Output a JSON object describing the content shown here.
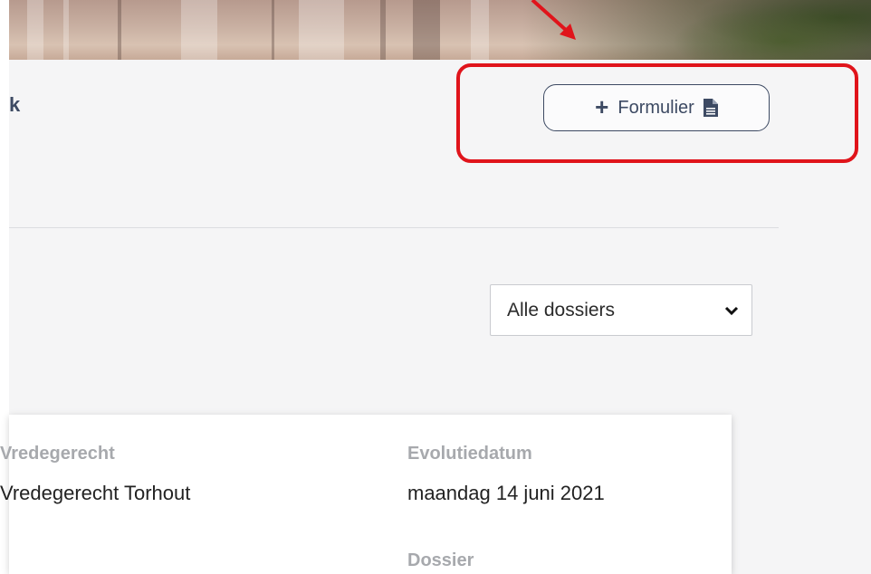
{
  "header": {
    "title_fragment": "k",
    "add_form_button": {
      "label": "Formulier",
      "icon": "document-icon",
      "plus_icon": "plus-icon"
    }
  },
  "filter": {
    "selected": "Alle dossiers",
    "icon": "chevron-down-icon"
  },
  "card": {
    "court_label": "Vredegerecht",
    "court_value": "Vredegerecht Torhout",
    "date_label": "Evolutiedatum",
    "date_value": "maandag 14 juni 2021",
    "dossier_label": "Dossier"
  },
  "annotation": {
    "highlight_color": "#e0141b"
  },
  "colors": {
    "accent": "#3d4a63",
    "label_gray": "#a7a9ad",
    "background": "#f5f5f6"
  }
}
